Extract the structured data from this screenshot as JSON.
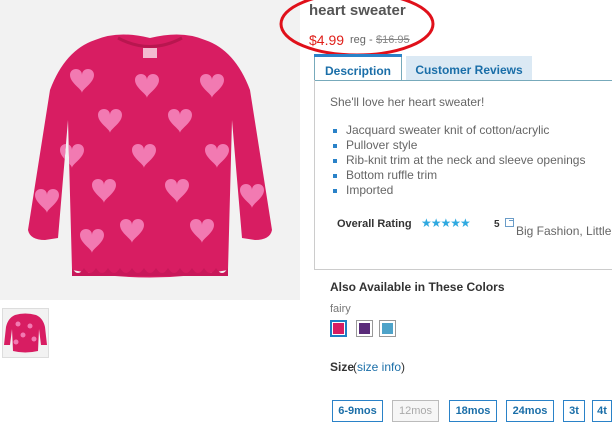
{
  "product": {
    "title": "heart sweater",
    "price_sale": "$4.99",
    "price_reg_label": "reg -",
    "price_original": "$16.95"
  },
  "tabs": [
    {
      "label": "Description",
      "active": true
    },
    {
      "label": "Customer Reviews",
      "active": false
    }
  ],
  "description": {
    "tagline": "She'll love her heart sweater!",
    "features": [
      "Jacquard sweater knit of cotton/acrylic",
      "Pullover style",
      "Rib-knit trim at the neck and sleeve openings",
      "Bottom ruffle trim",
      "Imported"
    ]
  },
  "rating": {
    "label": "Overall Rating",
    "stars": "★★★★★",
    "value": "5",
    "review_author": "Big Fashion, Little"
  },
  "colors": {
    "title": "Also Available in These Colors",
    "selected_name": "fairy",
    "swatches": [
      {
        "name": "fairy",
        "color": "#d81d62",
        "selected": true
      },
      {
        "name": "purple",
        "color": "#5a2b7a",
        "selected": false
      },
      {
        "name": "blue",
        "color": "#4ea3c9",
        "selected": false
      }
    ]
  },
  "size": {
    "label": "Size",
    "open_paren": "(",
    "info_link": "size info",
    "close_paren": ")",
    "options": [
      {
        "label": "6-9mos",
        "available": true
      },
      {
        "label": "12mos",
        "available": false
      },
      {
        "label": "18mos",
        "available": true
      },
      {
        "label": "24mos",
        "available": true
      },
      {
        "label": "3t",
        "available": true
      },
      {
        "label": "4t",
        "available": true
      }
    ]
  },
  "accent_colors": {
    "sweater_pink": "#d81d62",
    "heart_pink": "#f27ab2",
    "link_blue": "#1a6ea8",
    "annotation_red": "#e0101a"
  }
}
